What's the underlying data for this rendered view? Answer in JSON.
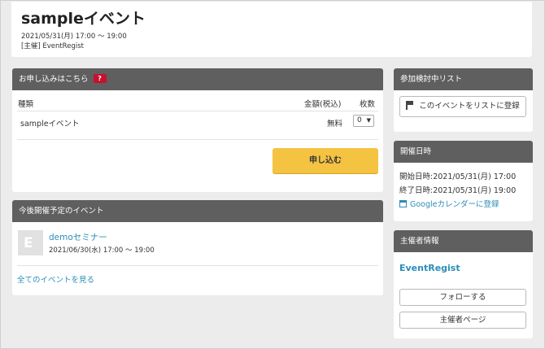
{
  "event": {
    "title": "sampleイベント",
    "date": "2021/05/31(月) 17:00 〜 19:00",
    "organizer": "[主催] EventRegist"
  },
  "apply": {
    "heading": "お申し込みはこちら",
    "help_badge": "?",
    "col_type": "種類",
    "col_price": "金額(税込)",
    "col_qty": "枚数",
    "ticket_name": "sampleイベント",
    "ticket_price": "無料",
    "qty_value": "0",
    "submit_label": "申し込む"
  },
  "upcoming": {
    "heading": "今後開催予定のイベント",
    "items": [
      {
        "name": "demoセミナー",
        "date": "2021/06/30(水) 17:00 〜 19:00"
      }
    ],
    "all_link": "全てのイベントを見る"
  },
  "watchlist": {
    "heading": "参加検討中リスト",
    "button_label": "このイベントをリストに登録",
    "icon": "flag-icon"
  },
  "schedule": {
    "heading": "開催日時",
    "start": "開始日時:2021/05/31(月) 17:00",
    "end": "終了日時:2021/05/31(月) 19:00",
    "gcal_link": "Googleカレンダーに登録",
    "icon": "calendar-icon"
  },
  "organizer_info": {
    "heading": "主催者情報",
    "name": "EventRegist",
    "follow_label": "フォローする",
    "page_label": "主催者ページ"
  }
}
